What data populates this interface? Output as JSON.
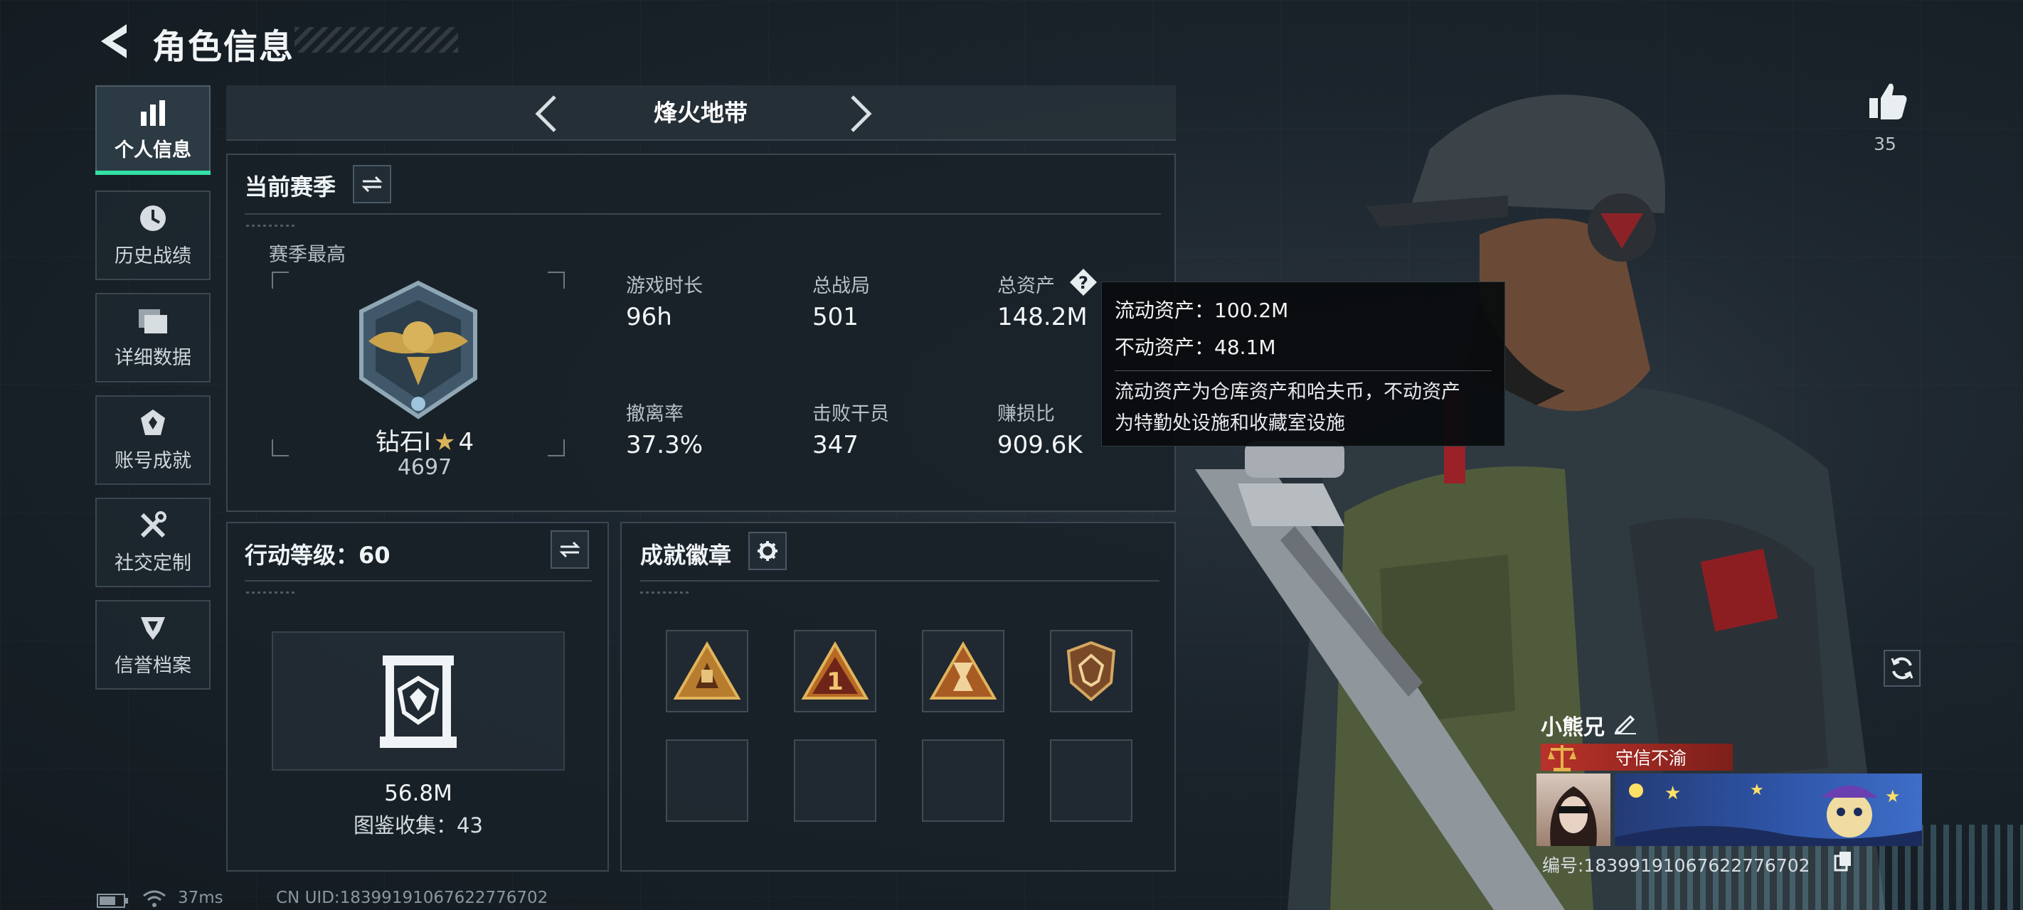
{
  "header": {
    "title": "角色信息"
  },
  "sidebar": {
    "items": [
      {
        "label": "个人信息",
        "icon": "bar-chart-icon",
        "active": true
      },
      {
        "label": "历史战绩",
        "icon": "clock-icon"
      },
      {
        "label": "详细数据",
        "icon": "folder-icon"
      },
      {
        "label": "账号成就",
        "icon": "achievement-icon"
      },
      {
        "label": "社交定制",
        "icon": "tools-icon"
      },
      {
        "label": "信誉档案",
        "icon": "reputation-icon"
      }
    ]
  },
  "mode": {
    "label": "烽火地带"
  },
  "season": {
    "title": "当前赛季",
    "best_label": "赛季最高",
    "rank_name": "钻石Ⅰ",
    "rank_stars": "4",
    "rank_score": "4697",
    "stats": [
      {
        "label": "游戏时长",
        "value": "96h"
      },
      {
        "label": "总战局",
        "value": "501"
      },
      {
        "label": "总资产",
        "value": "148.2M"
      },
      {
        "label": "撤离率",
        "value": "37.3%"
      },
      {
        "label": "击败干员",
        "value": "347"
      },
      {
        "label": "赚损比",
        "value": "909.6K"
      }
    ]
  },
  "action_level": {
    "title": "行动等级：60",
    "value": "56.8M",
    "collection": "图鉴收集：43"
  },
  "badges": {
    "title": "成就徽章"
  },
  "tooltip": {
    "liquid": "流动资产：100.2M",
    "fixed": "不动资产：48.1M",
    "note_line1": "流动资产为仓库资产和哈夫币，不动资产",
    "note_line2": "为特勤处设施和收藏室设施"
  },
  "profile": {
    "likes": "35",
    "name": "小熊兄",
    "honor": "守信不渝",
    "id": "编号:18399191067622776702"
  },
  "status": {
    "ping": "37ms",
    "uid": "CN UID:18399191067622776702"
  },
  "colors": {
    "accent": "#32e1a4",
    "honor_red": "#b8322a",
    "gold": "#c9a24a"
  }
}
